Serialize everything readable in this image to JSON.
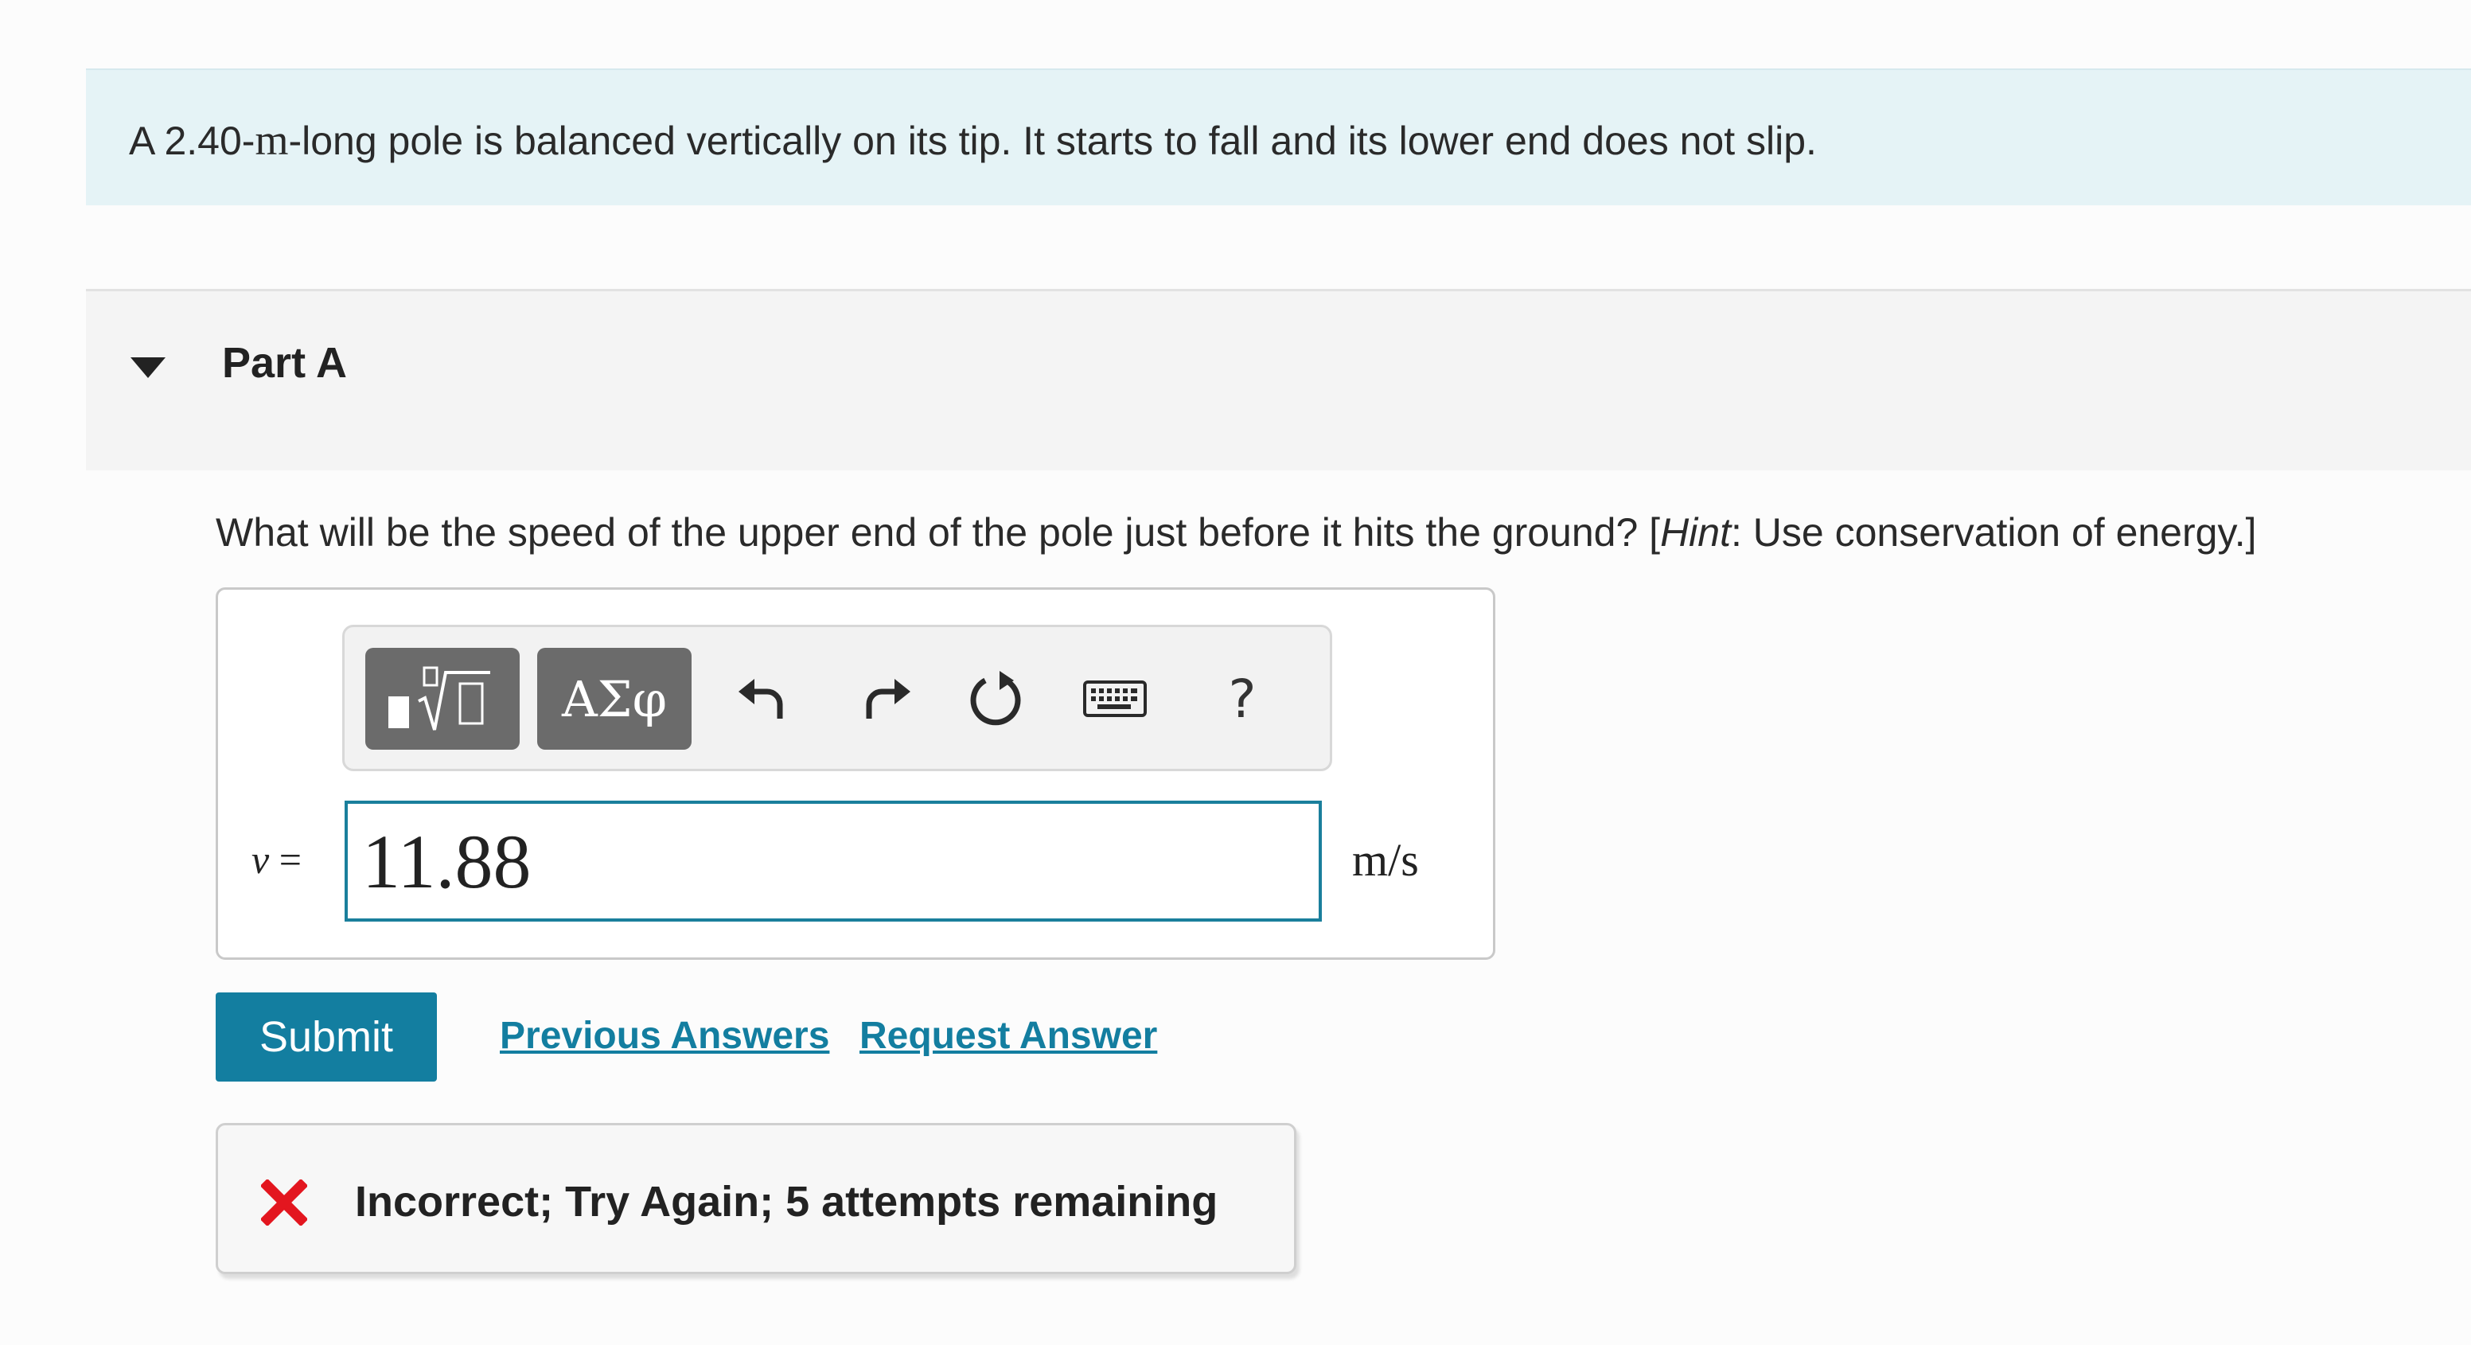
{
  "problem": {
    "text_before": "A 2.40-",
    "unit": "m",
    "text_after": "-long pole is balanced vertically on its tip. It starts to fall and its lower end does not slip."
  },
  "part": {
    "title": "Part A"
  },
  "question": {
    "text": "What will be the speed of the upper end of the pole just before it hits the ground? [",
    "hint_label": "Hint",
    "hint_text": ": Use conservation of energy.]"
  },
  "toolbar": {
    "templates_icon": "templates-radical-icon",
    "greek_label": "ΑΣφ",
    "undo_icon": "undo-icon",
    "redo_icon": "redo-icon",
    "reset_icon": "reset-icon",
    "keyboard_icon": "keyboard-icon",
    "help_label": "?"
  },
  "answer": {
    "variable": "v",
    "equals": " =",
    "value": "11.88",
    "unit": "m/s"
  },
  "actions": {
    "submit_label": "Submit",
    "previous_answers_label": "Previous Answers",
    "request_answer_label": "Request Answer"
  },
  "feedback": {
    "text": "Incorrect; Try Again; 5 attempts remaining",
    "icon": "incorrect-x-icon",
    "icon_color": "#e3161f"
  },
  "colors": {
    "accent": "#137ea0",
    "banner_bg": "#e5f3f6",
    "header_bg": "#f4f4f4"
  }
}
